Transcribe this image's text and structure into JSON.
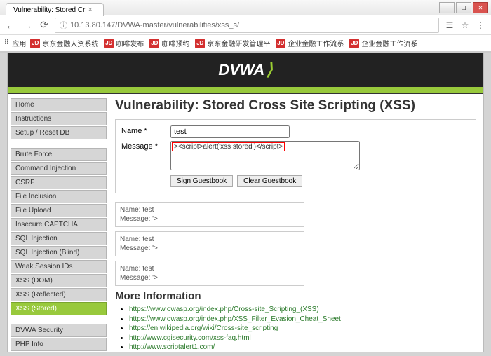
{
  "window": {
    "tab_title": "Vulnerability: Stored Cr",
    "url": "10.13.80.147/DVWA-master/vulnerabilities/xss_s/"
  },
  "bookmarks": {
    "apps_label": "应用",
    "items": [
      {
        "label": "京东金融人资系统"
      },
      {
        "label": "咖啡发布"
      },
      {
        "label": "咖啡预约"
      },
      {
        "label": "京东金融研发管理平"
      },
      {
        "label": "企业金融工作流系"
      },
      {
        "label": "企业金融工作流系"
      }
    ]
  },
  "sidebar": {
    "section1": [
      {
        "label": "Home"
      },
      {
        "label": "Instructions"
      },
      {
        "label": "Setup / Reset DB"
      }
    ],
    "section2": [
      {
        "label": "Brute Force"
      },
      {
        "label": "Command Injection"
      },
      {
        "label": "CSRF"
      },
      {
        "label": "File Inclusion"
      },
      {
        "label": "File Upload"
      },
      {
        "label": "Insecure CAPTCHA"
      },
      {
        "label": "SQL Injection"
      },
      {
        "label": "SQL Injection (Blind)"
      },
      {
        "label": "Weak Session IDs"
      },
      {
        "label": "XSS (DOM)"
      },
      {
        "label": "XSS (Reflected)"
      },
      {
        "label": "XSS (Stored)",
        "active": true
      }
    ],
    "section3": [
      {
        "label": "DVWA Security"
      },
      {
        "label": "PHP Info"
      }
    ]
  },
  "main": {
    "heading": "Vulnerability: Stored Cross Site Scripting (XSS)",
    "form": {
      "name_label": "Name *",
      "name_value": "test",
      "message_label": "Message *",
      "message_value": "",
      "message_highlight": "><script>alert('xss stored')</script>",
      "sign_btn": "Sign Guestbook",
      "clear_btn": "Clear Guestbook"
    },
    "entries": [
      {
        "name_line": "Name: test",
        "msg_line": "Message: '>"
      },
      {
        "name_line": "Name: test",
        "msg_line": "Message: '>"
      },
      {
        "name_line": "Name: test",
        "msg_line": "Message: '>"
      }
    ],
    "more_info_heading": "More Information",
    "links": [
      "https://www.owasp.org/index.php/Cross-site_Scripting_(XSS)",
      "https://www.owasp.org/index.php/XSS_Filter_Evasion_Cheat_Sheet",
      "https://en.wikipedia.org/wiki/Cross-site_scripting",
      "http://www.cgisecurity.com/xss-faq.html",
      "http://www.scriptalert1.com/"
    ]
  }
}
